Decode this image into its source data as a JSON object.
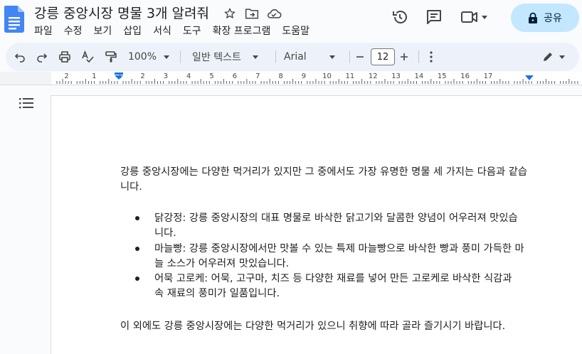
{
  "app": {
    "doc_title": "강릉 중앙시장 명물 3개 알려줘",
    "share_label": "공유"
  },
  "menu": [
    "파일",
    "수정",
    "보기",
    "삽입",
    "서식",
    "도구",
    "확장 프로그램",
    "도움말"
  ],
  "toolbar": {
    "zoom": "100%",
    "style": "일반 텍스트",
    "font": "Arial",
    "font_size": "12"
  },
  "ruler": {
    "labels": [
      "2",
      "1",
      "1",
      "2",
      "3",
      "4",
      "5",
      "6",
      "7",
      "8",
      "9",
      "10",
      "11",
      "12",
      "13",
      "14",
      "15",
      "16",
      "17"
    ]
  },
  "document": {
    "intro": "강릉 중앙시장에는 다양한 먹거리가 있지만 그 중에서도 가장 유명한 명물 세 가지는 다음과 같습니다.",
    "bullets": [
      "닭강정: 강릉 중앙시장의 대표 명물로 바삭한 닭고기와 달콤한 양념이 어우러져 맛있습니다.",
      "마늘빵: 강릉 중앙시장에서만 맛볼 수 있는 특제 마늘빵으로 바삭한 빵과 풍미 가득한 마늘 소스가 어우러져 맛있습니다.",
      "어묵 고로케: 어묵, 고구마, 치즈 등 다양한 재료를 넣어 만든 고로케로 바삭한 식감과 속 재료의 풍미가 일품입니다."
    ],
    "closing": "이 외에도 강릉 중앙시장에는 다양한 먹거리가 있으니 취향에 따라 골라 즐기시기 바랍니다."
  },
  "colors": {
    "doc_icon": "#4285f4",
    "share_bg": "#c2e7ff",
    "toolbar_bg": "#edf2fa",
    "ruler_marker": "#1a73e8"
  }
}
